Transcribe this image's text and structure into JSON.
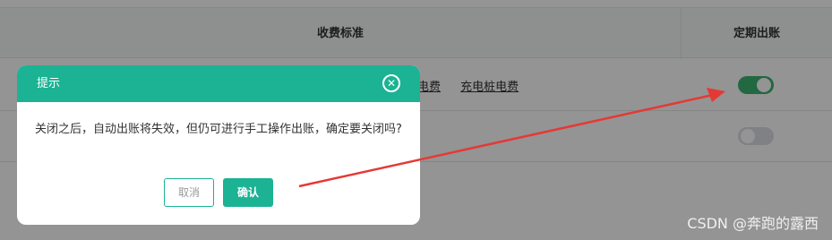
{
  "table": {
    "headers": {
      "fee_standard": "收费标准",
      "periodic_billing": "定期出账"
    },
    "row1_links": [
      "宿舍电费",
      "充电桩电费"
    ],
    "row1_toggle_on": true,
    "row2_toggle_on": false
  },
  "dialog": {
    "title": "提示",
    "close_icon": "close-circle-icon",
    "message": "关闭之后，自动出账将失效，但仍可进行手工操作出账，确定要关闭吗?",
    "cancel_label": "取消",
    "confirm_label": "确认"
  },
  "watermark": "CSDN @奔跑的露西",
  "colors": {
    "accent": "#1bb394",
    "toggle_on": "#3cb371",
    "annotation_arrow": "#e53935"
  }
}
